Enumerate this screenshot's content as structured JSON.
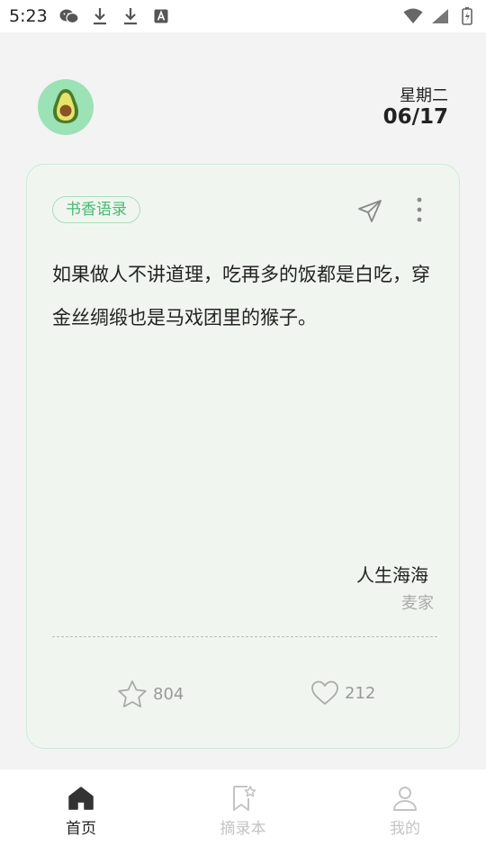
{
  "status_bar": {
    "time": "5:23"
  },
  "header": {
    "weekday": "星期二",
    "date": "06/17"
  },
  "card": {
    "category_tag": "书香语录",
    "quote": "如果做人不讲道理，吃再多的饭都是白吃，穿金丝绸缎也是马戏团里的猴子。",
    "book_title": "人生海海",
    "author": "麦家",
    "favorites_count": "804",
    "likes_count": "212"
  },
  "tabbar": {
    "tabs": [
      {
        "label": "首页",
        "icon": "home-icon",
        "active": true
      },
      {
        "label": "摘录本",
        "icon": "bookmark-star-icon",
        "active": false
      },
      {
        "label": "我的",
        "icon": "person-icon",
        "active": false
      }
    ]
  },
  "colors": {
    "accent": "#49b878",
    "card_background": "#f0f6ef",
    "card_border": "#cfe9da",
    "avatar_background": "#9be2b4"
  }
}
